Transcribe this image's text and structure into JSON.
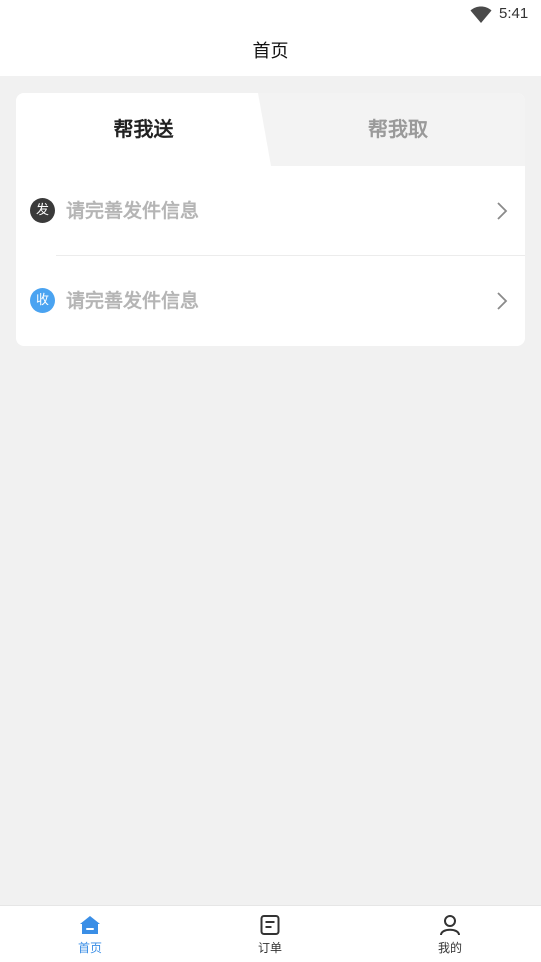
{
  "status_bar": {
    "time": "5:41",
    "wifi_icon": "wifi-icon"
  },
  "nav": {
    "title": "首页"
  },
  "card": {
    "tabs": [
      {
        "label": "帮我送",
        "active": true
      },
      {
        "label": "帮我取",
        "active": false
      }
    ],
    "rows": [
      {
        "badge": "发",
        "text": "请完善发件信息",
        "badge_color": "#3a3a3a",
        "icon": "chevron-right-icon"
      },
      {
        "badge": "收",
        "text": "请完善发件信息",
        "badge_color": "#4aa3f1",
        "icon": "chevron-right-icon"
      }
    ]
  },
  "tab_bar": {
    "items": [
      {
        "label": "首页",
        "icon": "home-icon",
        "active": true
      },
      {
        "label": "订单",
        "icon": "order-icon",
        "active": false
      },
      {
        "label": "我的",
        "icon": "user-icon",
        "active": false
      }
    ]
  },
  "colors": {
    "accent": "#3a8ee6",
    "background": "#f1f1f1",
    "muted_text": "#b5b5b5"
  }
}
